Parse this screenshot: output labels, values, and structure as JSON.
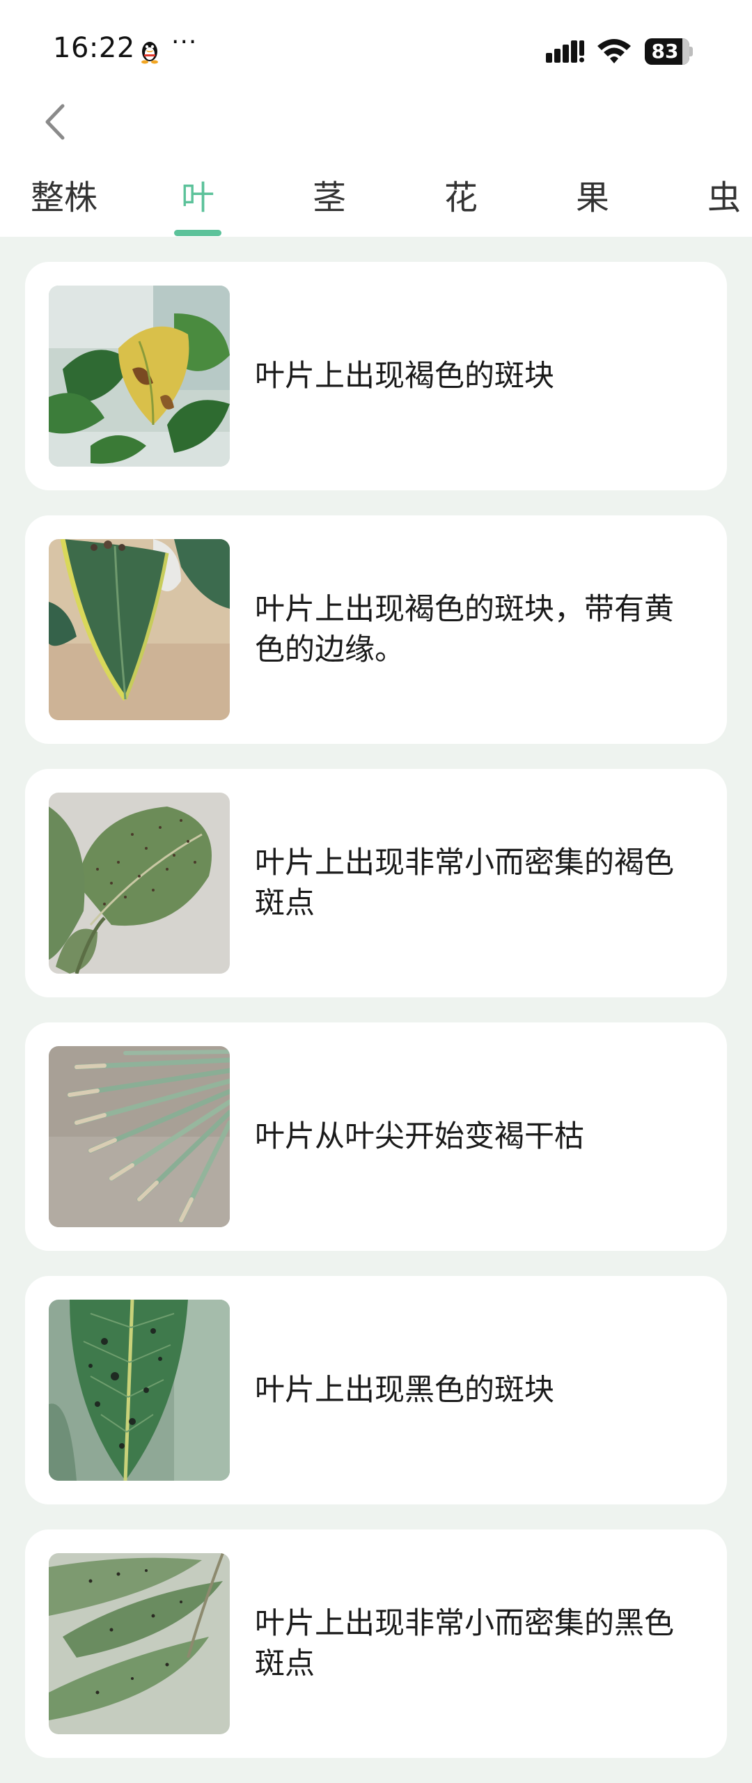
{
  "status_bar": {
    "time": "16:22",
    "more": "···",
    "battery": "83"
  },
  "nav": {
    "back_icon": "chevron-left-icon"
  },
  "tabs": [
    {
      "label": "整株",
      "active": false
    },
    {
      "label": "叶",
      "active": true
    },
    {
      "label": "茎",
      "active": false
    },
    {
      "label": "花",
      "active": false
    },
    {
      "label": "果",
      "active": false
    },
    {
      "label": "虫",
      "active": false
    }
  ],
  "colors": {
    "accent": "#5cc29a",
    "page_background": "#eef3ef",
    "card_background": "#ffffff"
  },
  "items": [
    {
      "text": "叶片上出现褐色的斑块",
      "image": "pothos-leaf-brown-patch"
    },
    {
      "text": "叶片上出现褐色的斑块，带有黄色的边缘。",
      "image": "heart-leaf-yellow-edge"
    },
    {
      "text": "叶片上出现非常小而密集的褐色斑点",
      "image": "fiddle-leaf-speckles"
    },
    {
      "text": "叶片从叶尖开始变褐干枯",
      "image": "palm-leaf-brown-tips"
    },
    {
      "text": "叶片上出现黑色的斑块",
      "image": "leaf-black-spots"
    },
    {
      "text": "叶片上出现非常小而密集的黑色斑点",
      "image": "leaves-black-speckles"
    }
  ]
}
